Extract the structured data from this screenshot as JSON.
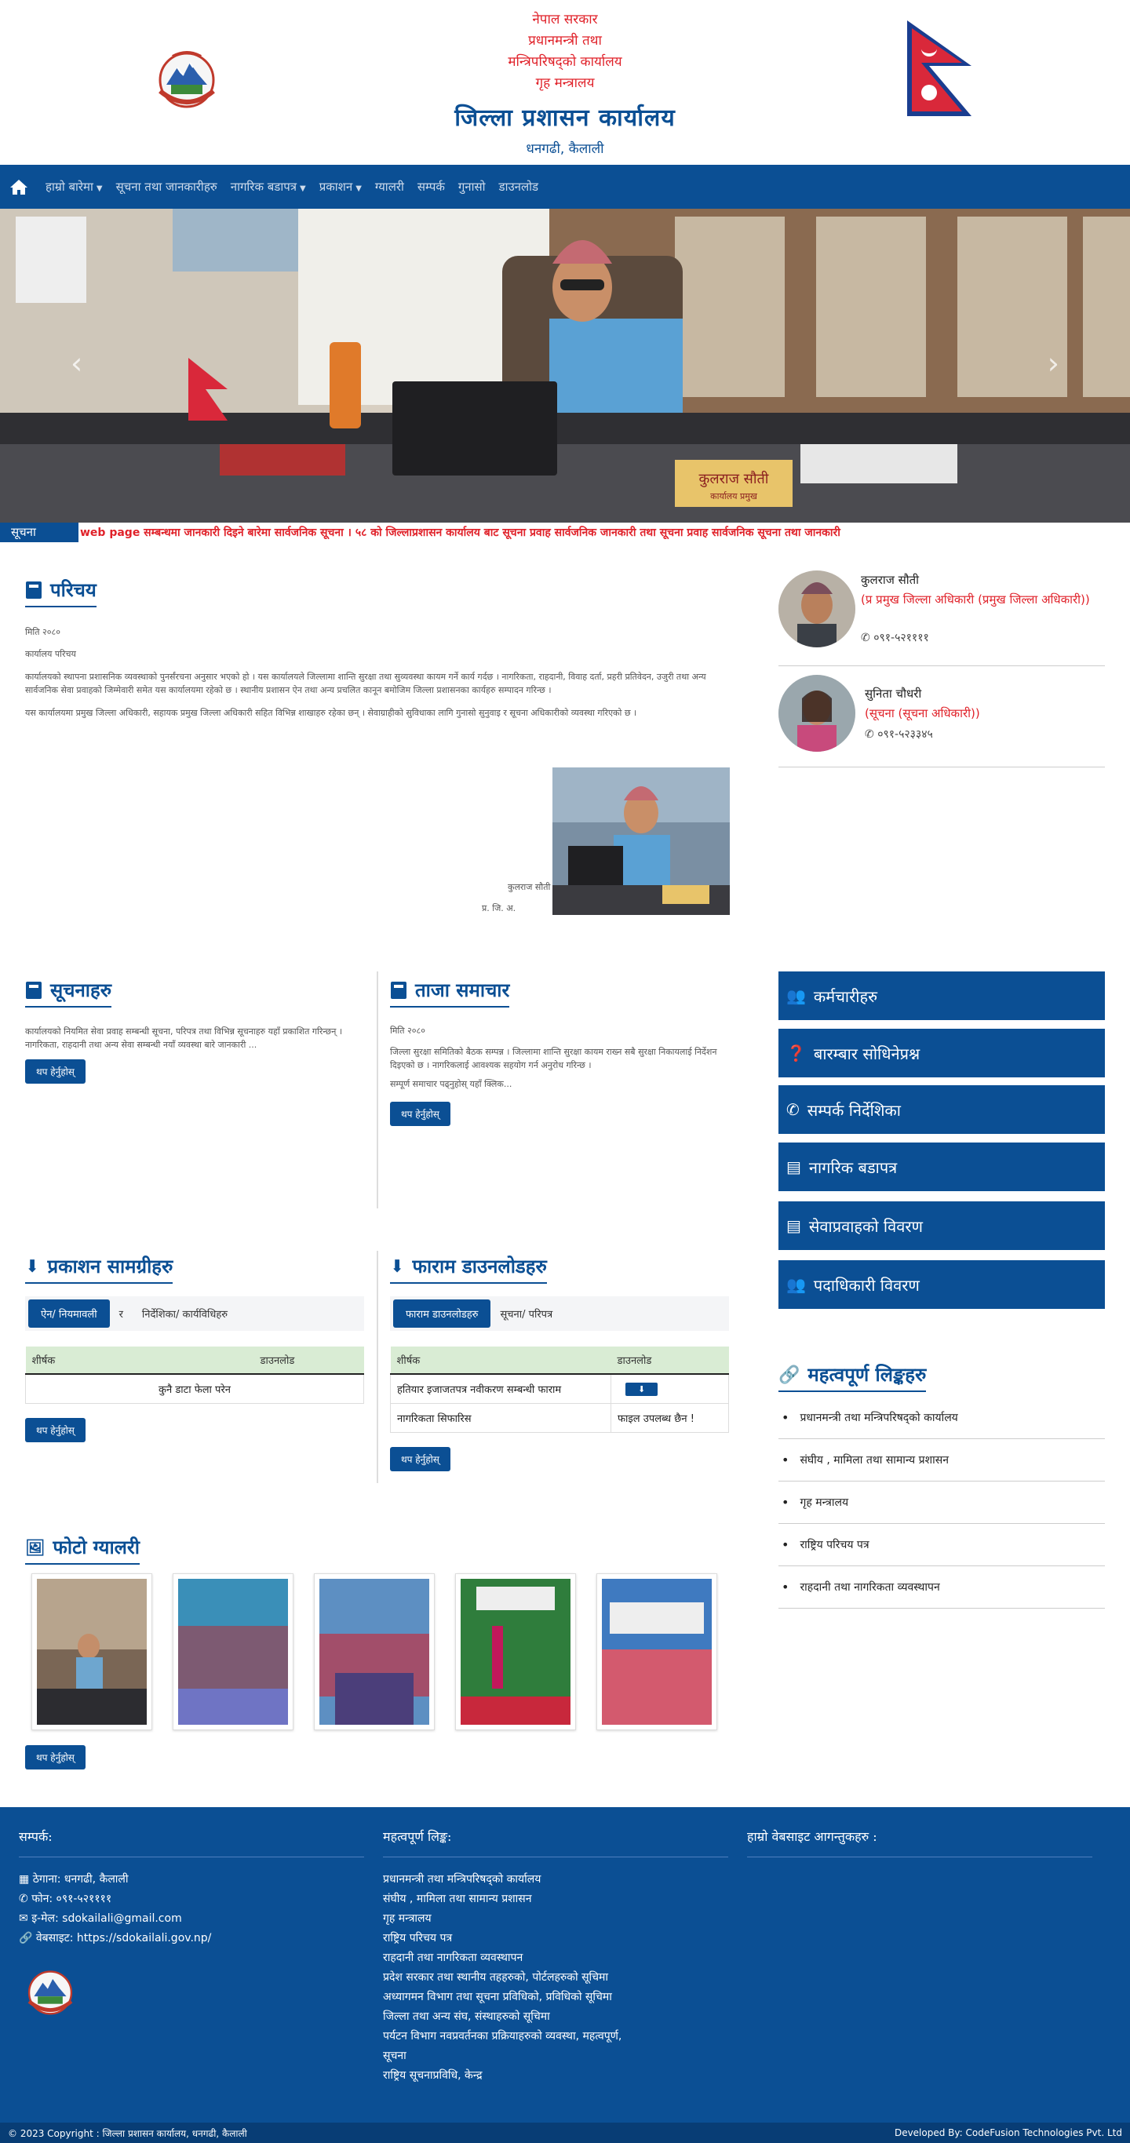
{
  "header": {
    "lines": [
      "नेपाल सरकार",
      "प्रधानमन्त्री तथा",
      "मन्त्रिपरिषद्को कार्यालय",
      "गृह मन्त्रालय"
    ],
    "title": "जिल्ला प्रशासन कार्यालय",
    "subtitle": "धनगढी, कैलाली",
    "colors": {
      "brand": "#0b4f94",
      "accent_red": "#e0222a"
    }
  },
  "nav": {
    "home_icon": "home-icon",
    "items": [
      {
        "label": "हाम्रो बारेमा",
        "dropdown": true
      },
      {
        "label": "सूचना तथा जानकारीहरु",
        "dropdown": false
      },
      {
        "label": "नागरिक बडापत्र",
        "dropdown": true
      },
      {
        "label": "प्रकाशन",
        "dropdown": true
      },
      {
        "label": "ग्यालरी",
        "dropdown": false
      },
      {
        "label": "सम्पर्क",
        "dropdown": false
      },
      {
        "label": "गुनासो",
        "dropdown": false
      },
      {
        "label": "डाउनलोड",
        "dropdown": false
      }
    ]
  },
  "hero": {
    "name_plate": "कुलराज सौती",
    "name_plate_sub": "कार्यालय प्रमुख"
  },
  "ticker": {
    "label": "सूचना",
    "text": "web page सम्बन्धमा जानकारी दिइने बारेमा सार्वजनिक सूचना । ५८ को जिल्लाप्रशासन कार्यालय बाट सूचना प्रवाह सार्वजनिक जानकारी तथा सूचना प्रवाह सार्वजनिक सूचना तथा जानकारी"
  },
  "intro": {
    "title": "परिचय",
    "line1": "मिति २०८०",
    "line2": "कार्यालय परिचय",
    "para1": "कार्यालयको स्थापना प्रशासनिक व्यवस्थाको पुनर्संरचना अनुसार भएको हो । यस कार्यालयले जिल्लामा शान्ति सुरक्षा तथा सुव्यवस्था कायम गर्ने कार्य गर्दछ । नागरिकता, राहदानी, विवाह दर्ता, प्रहरी प्रतिवेदन, उजुरी तथा अन्य सार्वजनिक सेवा प्रवाहको जिम्मेवारी समेत यस कार्यालयमा रहेको छ । स्थानीय प्रशासन ऐन तथा अन्य प्रचलित कानून बमोजिम जिल्ला प्रशासनका कार्यहरु सम्पादन गरिन्छ ।",
    "para2": "यस कार्यालयमा प्रमुख जिल्ला अधिकारी, सहायक प्रमुख जिल्ला अधिकारी सहित विभिन्न शाखाहरु रहेका छन् । सेवाग्राहीको सुविधाका लागि गुनासो सुनुवाइ र सूचना अधिकारीको व्यवस्था गरिएको छ ।",
    "caption1": "कुलराज सौती",
    "caption2": "प्र. जि. अ."
  },
  "officials": [
    {
      "name": "कुलराज सौती",
      "role": "(प्र प्रमुख जिल्ला अधिकारी (प्रमुख जिल्ला अधिकारी))",
      "phone": "०९१-५२११११"
    },
    {
      "name": "सुनिता चौधरी",
      "role": "(सूचना (सूचना अधिकारी))",
      "phone": "०९१-५२३३४५"
    }
  ],
  "notices": {
    "title": "सूचनाहरु",
    "para": "कार्यालयको नियमित सेवा प्रवाह सम्बन्धी सूचना, परिपत्र तथा विभिन्न सूचनाहरु यहाँ प्रकाशित गरिन्छन् । नागरिकता, राहदानी तथा अन्य सेवा सम्बन्धी नयाँ व्यवस्था बारे जानकारी ...",
    "button": "थप हेर्नुहोस्"
  },
  "notice_board": {
    "title": "ताजा समाचार",
    "line": "मिति २०८०",
    "para": "जिल्ला सुरक्षा समितिको बैठक सम्पन्न । जिल्लामा शान्ति सुरक्षा कायम राख्न सबै सुरक्षा निकायलाई निर्देशन दिइएको छ । नागरिकलाई आवश्यक सहयोग गर्न अनुरोध गरिन्छ ।",
    "more": "सम्पूर्ण समाचार पढ्नुहोस् यहाँ क्लिक...",
    "button": "थप हेर्नुहोस्"
  },
  "quick_links": [
    {
      "label": "कर्मचारीहरु",
      "icon": "users-icon"
    },
    {
      "label": "बारम्बार सोधिनेप्रश्न",
      "icon": "question-icon"
    },
    {
      "label": "सम्पर्क निर्देशिका",
      "icon": "phone-icon"
    },
    {
      "label": "नागरिक बडापत्र",
      "icon": "book-icon"
    },
    {
      "label": "सेवाप्रवाहको विवरण",
      "icon": "book-icon"
    },
    {
      "label": "पदाधिकारी विवरण",
      "icon": "users-icon"
    }
  ],
  "downloads": {
    "title": "प्रकाशन सामग्रीहरु",
    "tabs": [
      "ऐन/ नियमावली",
      "र",
      "निर्देशिका/ कार्यविधिहरु"
    ],
    "headers": [
      "शीर्षक",
      "डाउनलोड"
    ],
    "empty": "कुनै डाटा फेला परेन",
    "button": "थप हेर्नुहोस्"
  },
  "forms": {
    "title": "फाराम डाउनलोडहरु",
    "tabs": [
      "फाराम डाउनलोडहरु",
      "सूचना/ परिपत्र"
    ],
    "headers": [
      "शीर्षक",
      "डाउनलोड"
    ],
    "rows": [
      {
        "title": "हतियार इजाजतपत्र नवीकरण सम्बन्धी फाराम",
        "download": "download-icon"
      },
      {
        "title": "नागरिकता सिफारिस",
        "download": "फाइल उपलब्ध छैन !"
      }
    ],
    "button": "थप हेर्नुहोस्"
  },
  "important_links": {
    "title": "महत्वपूर्ण लिङ्कहरु",
    "items": [
      "प्रधानमन्त्री तथा मन्त्रिपरिषद्को कार्यालय",
      "संघीय , मामिला तथा सामान्य प्रशासन",
      "गृह मन्त्रालय",
      "राष्ट्रिय परिचय पत्र",
      "राहदानी तथा नागरिकता व्यवस्थापन"
    ]
  },
  "gallery": {
    "title": "फोटो ग्यालरी",
    "button": "थप हेर्नुहोस्"
  },
  "footer": {
    "contact_title": "सम्पर्क:",
    "address": "ठेगाना: धनगढी, कैलाली",
    "phone": "फोन: ०९१-५२११११",
    "email": "इ-मेल: sdokailali@gmail.com",
    "website": "वेबसाइट: https://sdokailali.gov.np/",
    "links_title": "महत्वपूर्ण लिङ्क:",
    "links": [
      "प्रधानमन्त्री तथा मन्त्रिपरिषद्को कार्यालय",
      "संघीय , मामिला तथा सामान्य प्रशासन",
      "गृह मन्त्रालय",
      "राष्ट्रिय परिचय पत्र",
      "राहदानी तथा नागरिकता व्यवस्थापन",
      "प्रदेश सरकार तथा स्थानीय तहहरुको, पोर्टलहरुको सूचिमा",
      "अध्यागमन विभाग तथा सूचना प्रविधिको, प्रविधिको सूचिमा",
      "जिल्ला तथा अन्य संघ, संस्थाहरुको सूचिमा",
      "पर्यटन विभाग नवप्रवर्तनका प्रक्रियाहरुको व्यवस्था, महत्वपूर्ण,",
      "सूचना",
      "राष्ट्रिय सूचनाप्रविधि, केन्द्र"
    ],
    "visitors_title": "हाम्रो वेबसाइट आगन्तुकहरु :"
  },
  "bottom": {
    "copyright": "© 2023 Copyright : जिल्ला प्रशासन कार्यालय, धनगढी, कैलाली",
    "developer": "Developed By: CodeFusion Technologies Pvt. Ltd"
  }
}
